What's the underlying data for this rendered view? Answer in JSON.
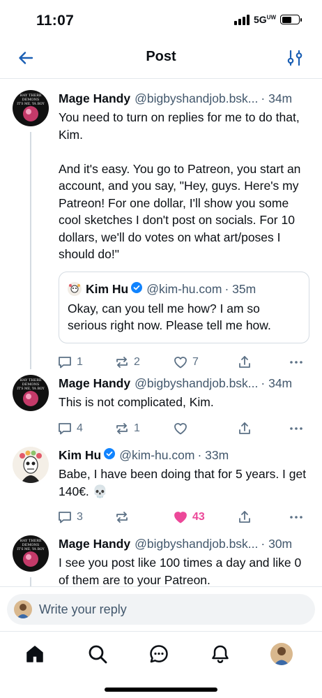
{
  "status_bar": {
    "time": "11:07",
    "network": "5G",
    "network_sup": "UW"
  },
  "header": {
    "title": "Post",
    "back_icon": "arrow-left-icon",
    "filter_icon": "sliders-icon"
  },
  "posts": [
    {
      "name": "Mage Handy",
      "handle": "@bigbyshandjob.bsk...",
      "time": "· 34m",
      "avatar_text": [
        "HAY THERE",
        "DEMONS",
        "IT'S ME, YA BOY"
      ],
      "text": "You need to turn on replies for me to do that, Kim.\n\nAnd it's easy. You go to Patreon, you start an account, and you say, \"Hey, guys. Here's my Patreon! For one dollar, I'll show you some cool sketches I don't post on socials. For 10 dollars, we'll do votes on what art/poses I should do!\"",
      "quote": {
        "name": "Kim Hu",
        "handle": "@kim-hu.com",
        "time": "· 35m",
        "text": "Okay, can you tell me how? I am so serious right now. Please tell me how."
      },
      "replies": "1",
      "reposts": "2",
      "likes": "7"
    },
    {
      "name": "Mage Handy",
      "handle": "@bigbyshandjob.bsk...",
      "time": "· 34m",
      "avatar_text": [
        "HAY THERE",
        "DEMONS",
        "IT'S ME, YA BOY"
      ],
      "text": "This is not complicated, Kim.",
      "replies": "4",
      "reposts": "1",
      "likes": ""
    },
    {
      "name": "Kim Hu",
      "handle": "@kim-hu.com",
      "time": "· 33m",
      "text": "Babe, I have been doing that for 5 years. I get 140€. 💀",
      "replies": "3",
      "reposts": "",
      "likes": "43",
      "liked": true
    },
    {
      "name": "Mage Handy",
      "handle": "@bigbyshandjob.bsk...",
      "time": "· 30m",
      "avatar_text": [
        "HAY THERE",
        "DEMONS",
        "IT'S ME, YA BOY"
      ],
      "text": "I see you post like 100 times a day and like 0 of them are to your Patreon."
    }
  ],
  "reply_bar": {
    "placeholder": "Write your reply"
  },
  "nav": {
    "items": [
      "home-icon",
      "search-icon",
      "chat-icon",
      "bell-icon",
      "profile-avatar"
    ]
  },
  "colors": {
    "accent": "#1083fe",
    "like": "#ec4899",
    "muted": "#42576c",
    "divider": "#e4e8ec"
  }
}
